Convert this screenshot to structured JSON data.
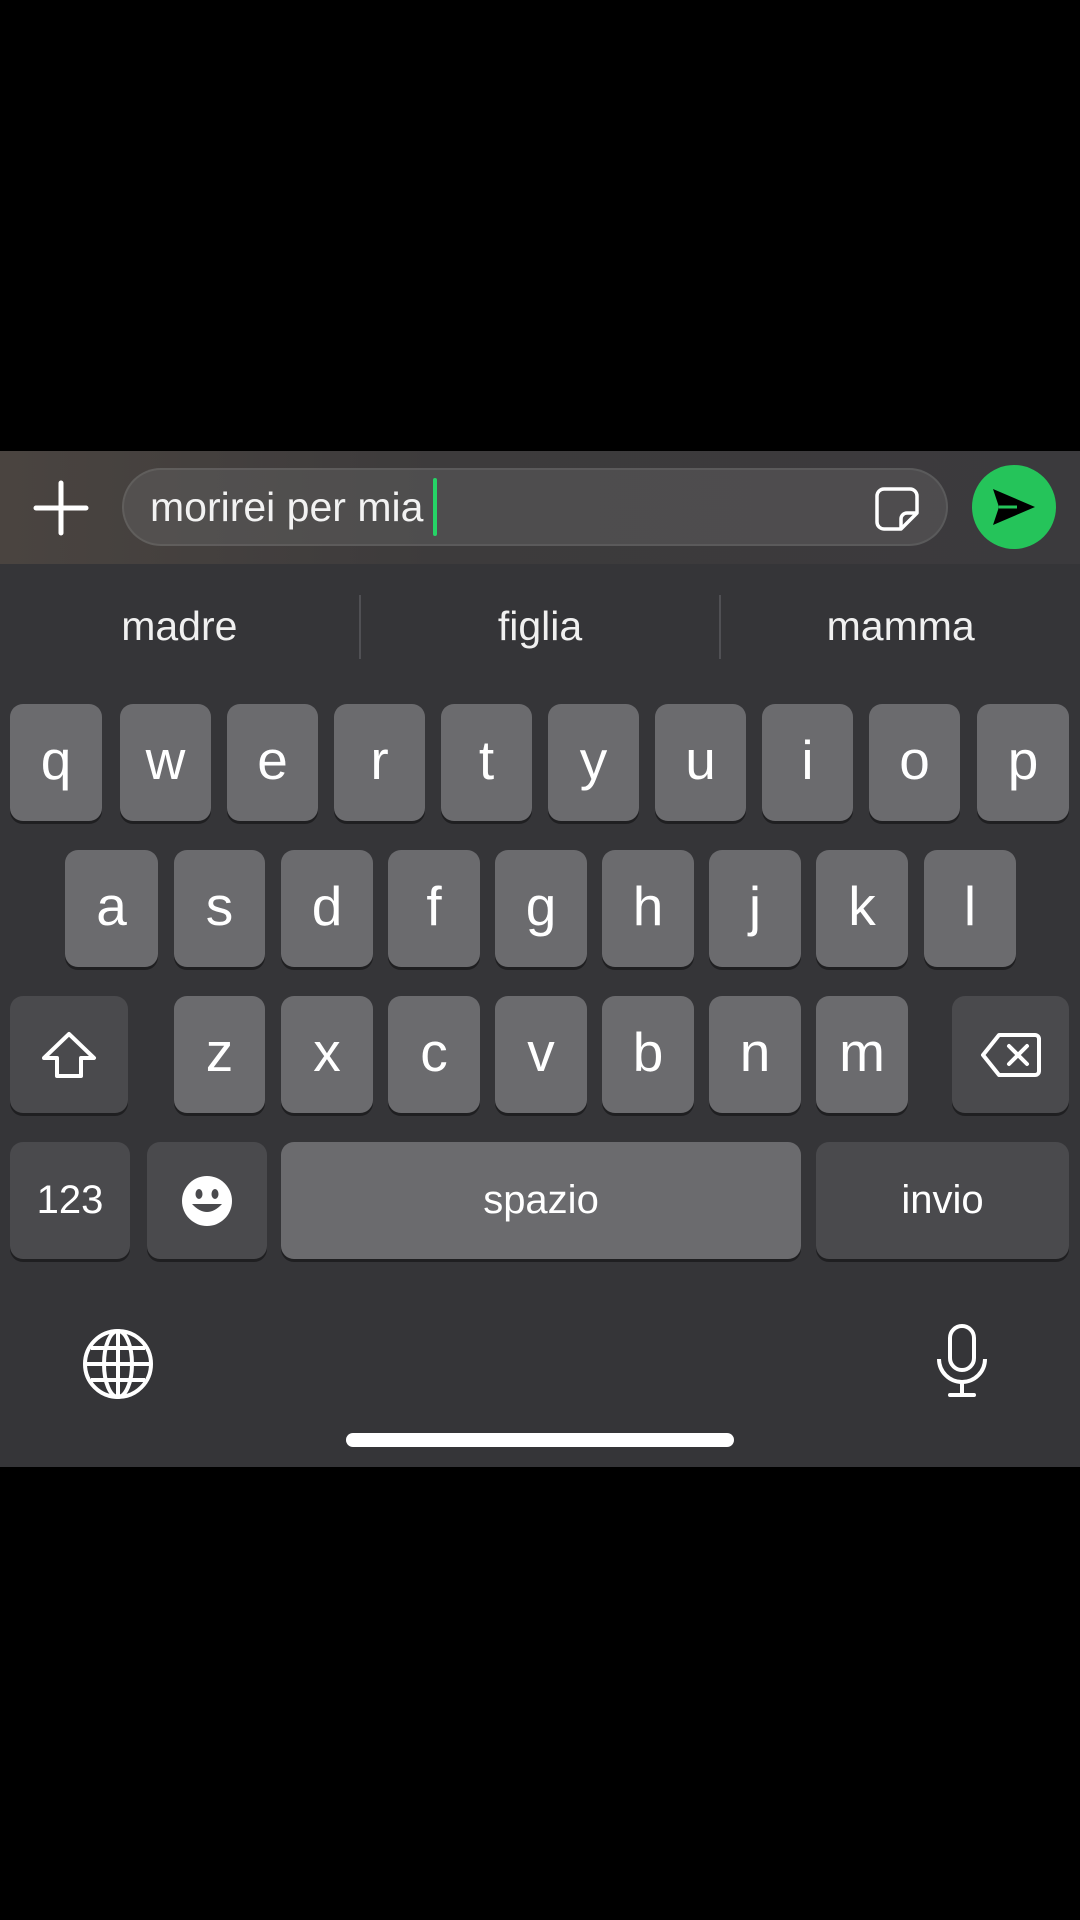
{
  "composer": {
    "message_text": "morirei per mia",
    "accent_color": "#25d366"
  },
  "suggestions": [
    "madre",
    "figlia",
    "mamma"
  ],
  "keyboard": {
    "row1": [
      "q",
      "w",
      "e",
      "r",
      "t",
      "y",
      "u",
      "i",
      "o",
      "p"
    ],
    "row2": [
      "a",
      "s",
      "d",
      "f",
      "g",
      "h",
      "j",
      "k",
      "l"
    ],
    "row3": [
      "z",
      "x",
      "c",
      "v",
      "b",
      "n",
      "m"
    ],
    "numbers_label": "123",
    "space_label": "spazio",
    "return_label": "invio"
  },
  "icons": {
    "attach": "plus-icon",
    "sticker": "sticker-icon",
    "send": "send-icon",
    "shift": "shift-icon",
    "delete": "backspace-icon",
    "emoji": "emoji-icon",
    "globe": "globe-icon",
    "mic": "microphone-icon"
  }
}
